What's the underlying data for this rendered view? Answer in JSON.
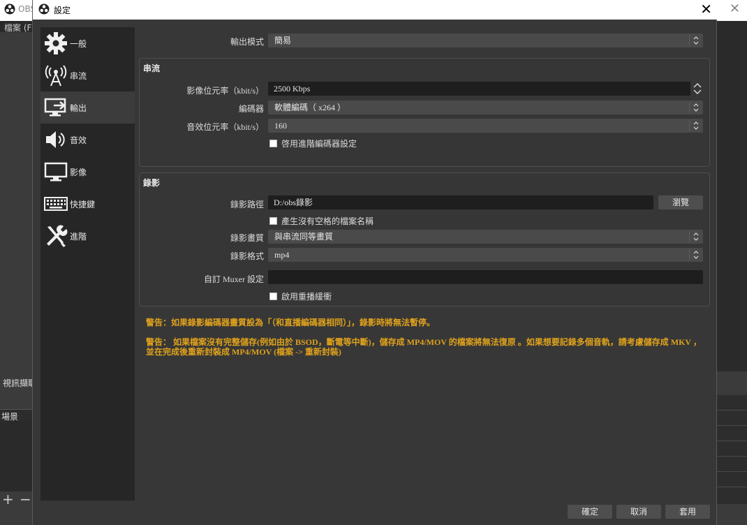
{
  "background_window": {
    "title": "OBS",
    "menu_first": "檔案 (F)",
    "video_capture_label": "視訊擷取",
    "scenes_label": "場景"
  },
  "dialog": {
    "title": "設定",
    "close_glyph": "✕"
  },
  "sidebar": {
    "items": [
      {
        "label": "一般",
        "icon": "gear-icon",
        "active": false
      },
      {
        "label": "串流",
        "icon": "broadcast-icon",
        "active": false
      },
      {
        "label": "輸出",
        "icon": "output-monitor-icon",
        "active": true
      },
      {
        "label": "音效",
        "icon": "speaker-icon",
        "active": false
      },
      {
        "label": "影像",
        "icon": "monitor-icon",
        "active": false
      },
      {
        "label": "快捷鍵",
        "icon": "keyboard-icon",
        "active": false
      },
      {
        "label": "進階",
        "icon": "tools-icon",
        "active": false
      }
    ]
  },
  "output_mode": {
    "label": "輸出模式",
    "value": "簡易"
  },
  "streaming": {
    "title": "串流",
    "video_bitrate": {
      "label": "影像位元率（kbit/s）",
      "value": "2500 Kbps"
    },
    "encoder": {
      "label": "編碼器",
      "value": "軟體編碼（ x264 ）"
    },
    "audio_bitrate": {
      "label": "音效位元率（kbit/s）",
      "value": "160"
    },
    "advanced_encoder_checkbox": "啓用進階編碼器設定"
  },
  "recording": {
    "title": "錄影",
    "path": {
      "label": "錄影路徑",
      "value": "D:/obs錄影",
      "browse": "瀏覽"
    },
    "no_space_checkbox": "產生沒有空格的檔案名稱",
    "quality": {
      "label": "錄影畫質",
      "value": "與串流同等畫質"
    },
    "format": {
      "label": "錄影格式",
      "value": "mp4"
    },
    "muxer": {
      "label": "自訂 Muxer 設定",
      "value": ""
    },
    "replay_buffer_checkbox": "啟用重播緩衝"
  },
  "warnings": [
    "警告：如果錄影編碼器畫質設為「（和直播編碼器相同）」，錄影時將無法暫停。",
    "警告： 如果檔案沒有完整儲存(例如由於 BSOD，斷電等中斷)，儲存成 MP4/MOV 的檔案將無法復原 。如果想要記錄多個音軌，請考慮儲存成 MKV ，並在完成後重新封裝成 MP4/MOV (檔案 -> 重新封裝)"
  ],
  "footer": {
    "ok": "確定",
    "cancel": "取消",
    "apply": "套用"
  },
  "colors": {
    "warning": "#e0a21b",
    "dialog_bg": "#373737",
    "sidebar_bg": "#262626",
    "field_bg": "#1e1e1e"
  }
}
